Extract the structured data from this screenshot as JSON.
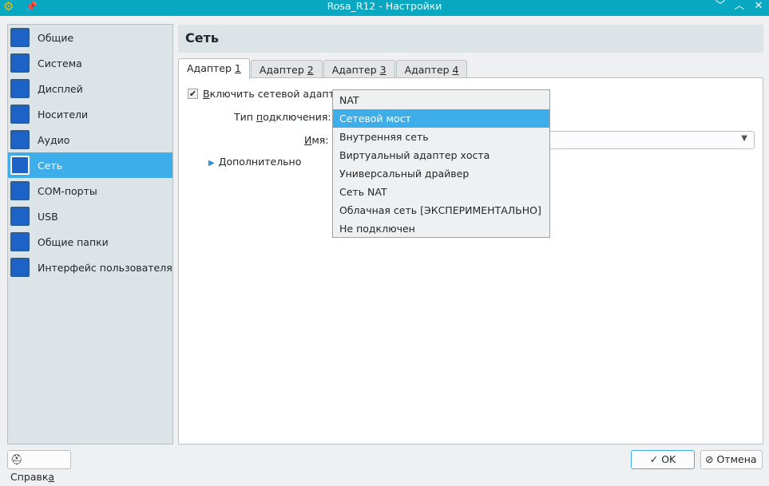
{
  "window": {
    "title": "Rosa_R12 - Настройки"
  },
  "sidebar": {
    "items": [
      {
        "label": "Общие",
        "icon": "general-icon"
      },
      {
        "label": "Система",
        "icon": "system-icon"
      },
      {
        "label": "Дисплей",
        "icon": "display-icon"
      },
      {
        "label": "Носители",
        "icon": "storage-icon"
      },
      {
        "label": "Аудио",
        "icon": "audio-icon"
      },
      {
        "label": "Сеть",
        "icon": "network-icon",
        "selected": true
      },
      {
        "label": "COM-порты",
        "icon": "serial-ports-icon"
      },
      {
        "label": "USB",
        "icon": "usb-icon"
      },
      {
        "label": "Общие папки",
        "icon": "shared-folders-icon"
      },
      {
        "label": "Интерфейс пользователя",
        "icon": "user-interface-icon"
      }
    ]
  },
  "page": {
    "title": "Сеть"
  },
  "tabs": [
    {
      "text": "Адаптер ",
      "n": "1"
    },
    {
      "text": "Адаптер ",
      "n": "2"
    },
    {
      "text": "Адаптер ",
      "n": "3"
    },
    {
      "text": "Адаптер ",
      "n": "4"
    }
  ],
  "form": {
    "enable_label_u": "В",
    "enable_label": "ключить сетевой адаптер",
    "enabled": true,
    "attached_label_a": "Тип ",
    "attached_label_u": "п",
    "attached_label_b": "одключения:",
    "name_label_u": "И",
    "name_label": "мя:",
    "advanced_u": "Д",
    "advanced": "ополнительно"
  },
  "dropdown": {
    "options": [
      "NAT",
      "Сетевой мост",
      "Внутренняя сеть",
      "Виртуальный адаптер хоста",
      "Универсальный драйвер",
      "Сеть NAT",
      "Облачная сеть [ЭКСПЕРИМЕНТАЛЬНО]",
      "Не подключен"
    ],
    "selected": 1
  },
  "buttons": {
    "help": "Справк",
    "help_u": "а",
    "ok": "OK",
    "cancel": "Отмена"
  }
}
